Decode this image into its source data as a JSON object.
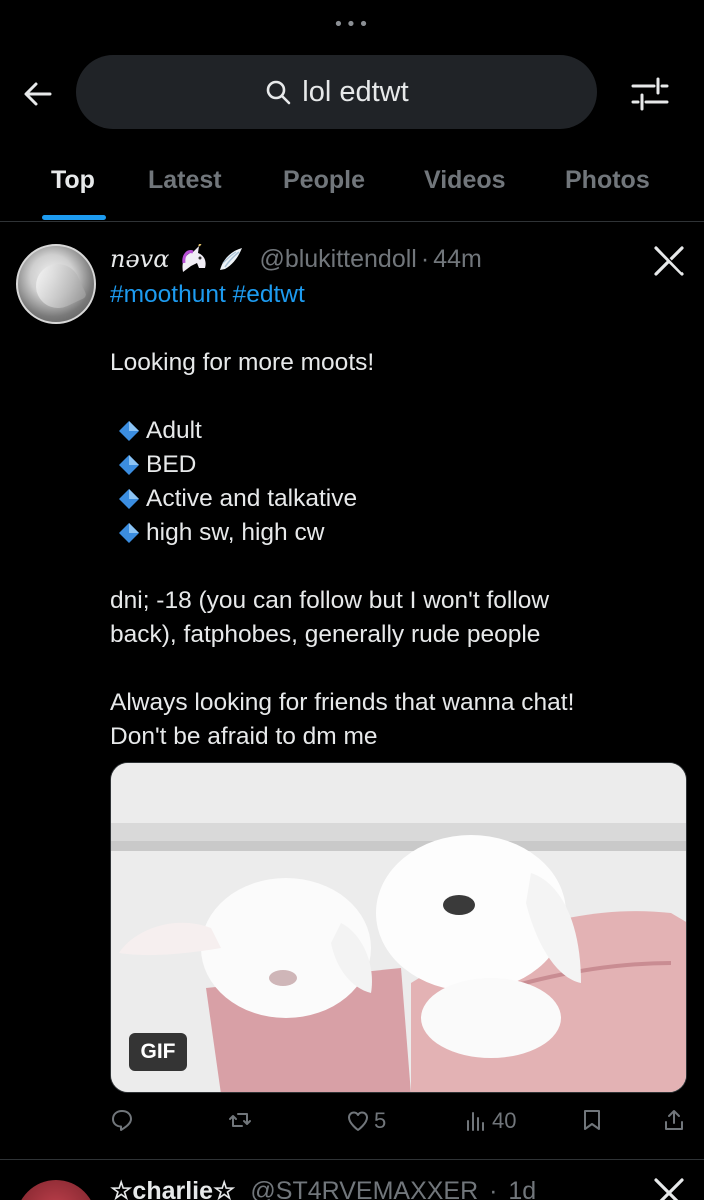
{
  "top_bar": {
    "handle_dots": "•••",
    "search_query": "lol edtwt"
  },
  "tabs": [
    {
      "label": "Top",
      "active": true
    },
    {
      "label": "Latest",
      "active": false
    },
    {
      "label": "People",
      "active": false
    },
    {
      "label": "Videos",
      "active": false
    },
    {
      "label": "Photos",
      "active": false
    }
  ],
  "post": {
    "display_name": "nəvα",
    "handle": "@blukittendoll",
    "separator": "·",
    "time": "44m",
    "hashtags": [
      "#moothunt",
      "#edtwt"
    ],
    "intro": "Looking for more moots!",
    "bullets": [
      "Adult",
      "BED",
      "Active and talkative",
      "high sw, high cw"
    ],
    "dni_line1": "dni; -18 (you can follow but I won't follow",
    "dni_line2": "back), fatphobes, generally rude people",
    "closing_line1": "Always looking for friends that wanna chat!",
    "closing_line2": "Don't be afraid to dm me",
    "media": {
      "badge": "GIF"
    },
    "actions": {
      "replies": "",
      "reposts": "",
      "likes": "5",
      "views": "40"
    }
  },
  "next_post": {
    "display_name": "☆charlie☆",
    "handle": "@ST4RVEMAXXER",
    "separator": "·",
    "time": "1d"
  },
  "colors": {
    "background": "#000000",
    "accent": "#1d9bf0",
    "muted": "#71767b",
    "search_bg": "#202327"
  }
}
